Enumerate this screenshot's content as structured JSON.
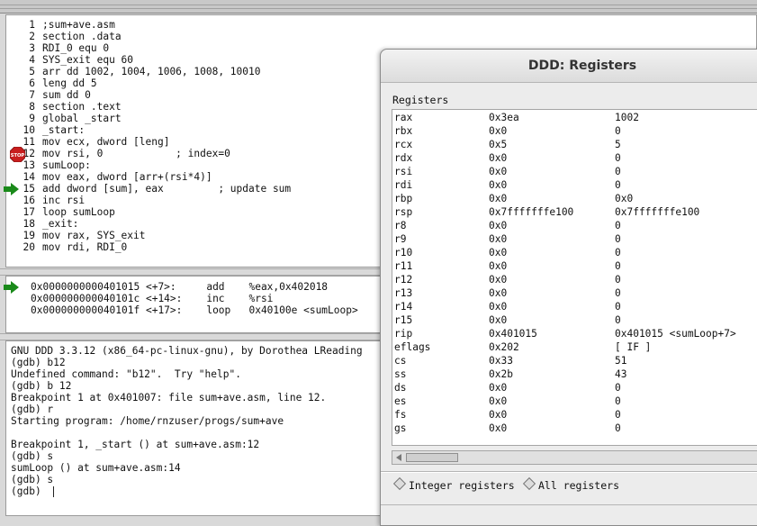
{
  "source": {
    "lines": [
      {
        "num": "1",
        "code": ";sum+ave.asm"
      },
      {
        "num": "2",
        "code": "section .data"
      },
      {
        "num": "3",
        "code": "RDI_0 equ 0"
      },
      {
        "num": "4",
        "code": "SYS_exit equ 60"
      },
      {
        "num": "5",
        "code": "arr dd 1002, 1004, 1006, 1008, 10010"
      },
      {
        "num": "6",
        "code": "leng dd 5"
      },
      {
        "num": "7",
        "code": "sum dd 0"
      },
      {
        "num": "8",
        "code": "section .text"
      },
      {
        "num": "9",
        "code": "global _start"
      },
      {
        "num": "10",
        "code": "_start:"
      },
      {
        "num": "11",
        "code": "mov ecx, dword [leng]"
      },
      {
        "num": "12",
        "code": "mov rsi, 0            ; index=0"
      },
      {
        "num": "13",
        "code": "sumLoop:"
      },
      {
        "num": "14",
        "code": "mov eax, dword [arr+(rsi*4)]"
      },
      {
        "num": "15",
        "code": "add dword [sum], eax         ; update sum"
      },
      {
        "num": "16",
        "code": "inc rsi"
      },
      {
        "num": "17",
        "code": "loop sumLoop"
      },
      {
        "num": "18",
        "code": "_exit:"
      },
      {
        "num": "19",
        "code": "mov rax, SYS_exit"
      },
      {
        "num": "20",
        "code": "mov rdi, RDI_0"
      }
    ],
    "breakpoint_line": 12,
    "current_line": 15
  },
  "machine": {
    "lines": [
      "0x0000000000401015 <+7>:     add    %eax,0x402018",
      "0x000000000040101c <+14>:    inc    %rsi",
      "0x000000000040101f <+17>:    loop   0x40100e <sumLoop>"
    ]
  },
  "console": {
    "lines": [
      "GNU DDD 3.3.12 (x86_64-pc-linux-gnu), by Dorothea LReading",
      "(gdb) b12",
      "Undefined command: \"b12\".  Try \"help\".",
      "(gdb) b 12",
      "Breakpoint 1 at 0x401007: file sum+ave.asm, line 12.",
      "(gdb) r",
      "Starting program: /home/rnzuser/progs/sum+ave",
      "",
      "Breakpoint 1, _start () at sum+ave.asm:12",
      "(gdb) s",
      "sumLoop () at sum+ave.asm:14",
      "(gdb) s",
      "(gdb) "
    ]
  },
  "registers_dialog": {
    "title": "DDD: Registers",
    "label": "Registers",
    "rows": [
      {
        "name": "rax",
        "raw": "0x3ea",
        "natural": "1002"
      },
      {
        "name": "rbx",
        "raw": "0x0",
        "natural": "0"
      },
      {
        "name": "rcx",
        "raw": "0x5",
        "natural": "5"
      },
      {
        "name": "rdx",
        "raw": "0x0",
        "natural": "0"
      },
      {
        "name": "rsi",
        "raw": "0x0",
        "natural": "0"
      },
      {
        "name": "rdi",
        "raw": "0x0",
        "natural": "0"
      },
      {
        "name": "rbp",
        "raw": "0x0",
        "natural": "0x0"
      },
      {
        "name": "rsp",
        "raw": "0x7fffffffe100",
        "natural": "0x7fffffffe100"
      },
      {
        "name": "r8",
        "raw": "0x0",
        "natural": "0"
      },
      {
        "name": "r9",
        "raw": "0x0",
        "natural": "0"
      },
      {
        "name": "r10",
        "raw": "0x0",
        "natural": "0"
      },
      {
        "name": "r11",
        "raw": "0x0",
        "natural": "0"
      },
      {
        "name": "r12",
        "raw": "0x0",
        "natural": "0"
      },
      {
        "name": "r13",
        "raw": "0x0",
        "natural": "0"
      },
      {
        "name": "r14",
        "raw": "0x0",
        "natural": "0"
      },
      {
        "name": "r15",
        "raw": "0x0",
        "natural": "0"
      },
      {
        "name": "rip",
        "raw": "0x401015",
        "natural": "0x401015 <sumLoop+7>"
      },
      {
        "name": "eflags",
        "raw": "0x202",
        "natural": "[ IF ]"
      },
      {
        "name": "cs",
        "raw": "0x33",
        "natural": "51"
      },
      {
        "name": "ss",
        "raw": "0x2b",
        "natural": "43"
      },
      {
        "name": "ds",
        "raw": "0x0",
        "natural": "0"
      },
      {
        "name": "es",
        "raw": "0x0",
        "natural": "0"
      },
      {
        "name": "fs",
        "raw": "0x0",
        "natural": "0"
      },
      {
        "name": "gs",
        "raw": "0x0",
        "natural": "0"
      }
    ],
    "radio_integer": "Integer registers",
    "radio_all": "All registers"
  },
  "colors": {
    "arrow": "#1a8a1a",
    "stop": "#c81e1e"
  },
  "icons": [
    "stop-sign-icon",
    "execution-arrow-icon",
    "scroll-left-icon",
    "scroll-right-icon"
  ]
}
